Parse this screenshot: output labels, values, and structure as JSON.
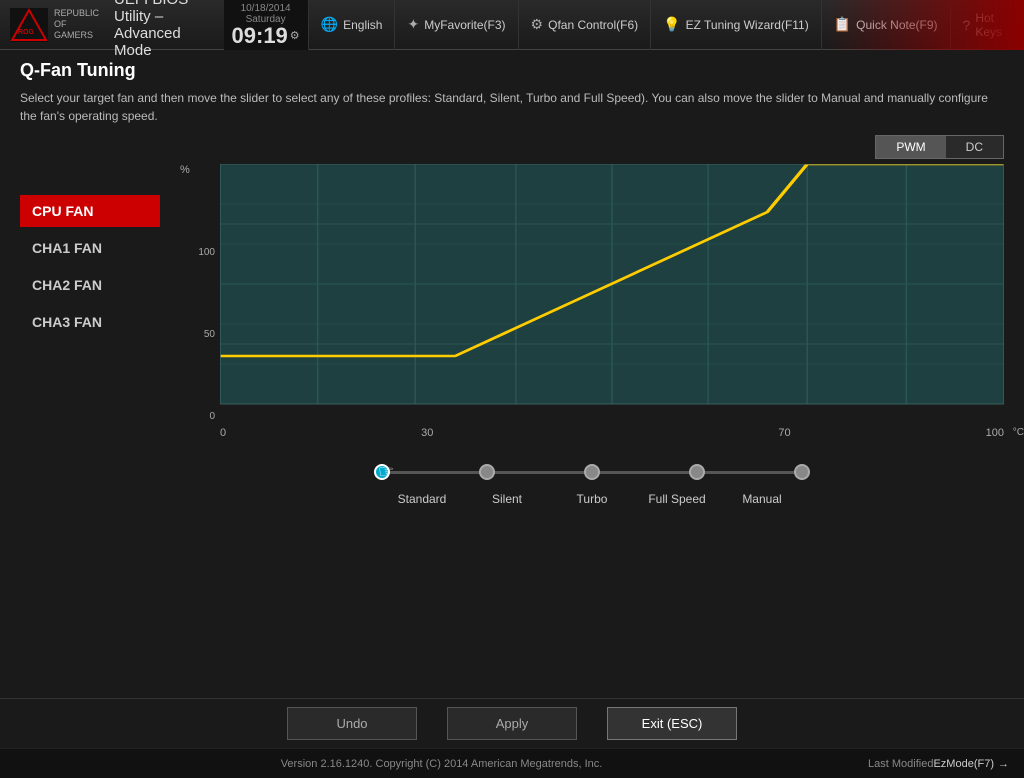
{
  "header": {
    "date": "10/18/2014",
    "day": "Saturday",
    "time": "09:19",
    "gear_icon": "⚙",
    "title": "UEFI BIOS Utility – Advanced Mode",
    "nav": [
      {
        "id": "language",
        "icon": "🌐",
        "label": "English",
        "shortcut": ""
      },
      {
        "id": "myfavorite",
        "icon": "☆",
        "label": "MyFavorite(F3)",
        "shortcut": "F3"
      },
      {
        "id": "qfan",
        "icon": "♨",
        "label": "Qfan Control(F6)",
        "shortcut": "F6"
      },
      {
        "id": "eztuning",
        "icon": "💡",
        "label": "EZ Tuning Wizard(F11)",
        "shortcut": "F11"
      },
      {
        "id": "quicknote",
        "icon": "📋",
        "label": "Quick Note(F9)",
        "shortcut": "F9"
      },
      {
        "id": "hotkeys",
        "icon": "?",
        "label": "Hot Keys",
        "shortcut": ""
      }
    ]
  },
  "section": {
    "title": "Q-Fan Tuning",
    "description": "Select your target fan and then move the slider to select any of these profiles: Standard, Silent, Turbo and\nFull Speed). You can also move the slider to Manual and manually configure the fan's operating speed."
  },
  "fan_list": [
    {
      "id": "cpu",
      "label": "CPU FAN",
      "active": true
    },
    {
      "id": "cha1",
      "label": "CHA1 FAN",
      "active": false
    },
    {
      "id": "cha2",
      "label": "CHA2 FAN",
      "active": false
    },
    {
      "id": "cha3",
      "label": "CHA3 FAN",
      "active": false
    }
  ],
  "pwm_dc": {
    "options": [
      "PWM",
      "DC"
    ],
    "active": "PWM"
  },
  "chart": {
    "y_label": "%",
    "y_max": "100",
    "y_mid": "50",
    "y_min": "0",
    "x_label": "°C",
    "x_vals": [
      "0",
      "30",
      "70",
      "100"
    ]
  },
  "slider": {
    "options": [
      "Standard",
      "Silent",
      "Turbo",
      "Full Speed",
      "Manual"
    ],
    "active_index": 0
  },
  "buttons": {
    "undo": "Undo",
    "apply": "Apply",
    "exit": "Exit (ESC)"
  },
  "statusbar": {
    "version": "Version 2.16.1240. Copyright (C) 2014 American Megatrends, Inc.",
    "last_modified": "Last Modified",
    "ez_mode": "EzMode(F7)",
    "arrow_icon": "→"
  }
}
